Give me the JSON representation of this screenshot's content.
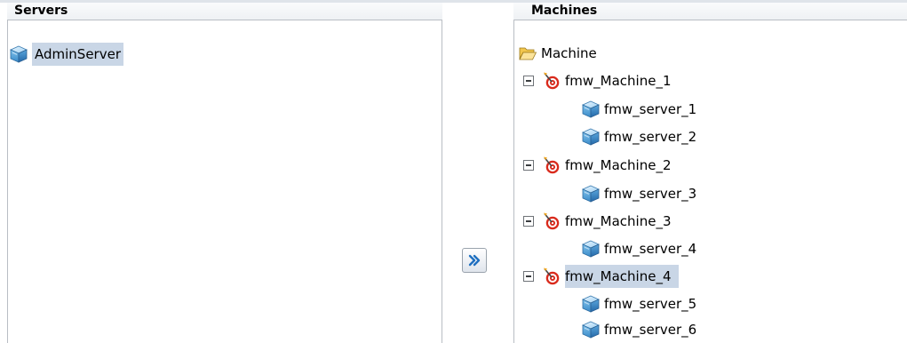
{
  "servers_panel": {
    "header": "Servers",
    "items": [
      {
        "label": "AdminServer",
        "icon": "server-icon",
        "selected": true
      }
    ]
  },
  "move_button": {
    "icon": "double-right-arrow-icon"
  },
  "machines_panel": {
    "header": "Machines",
    "root": {
      "label": "Machine",
      "icon": "folder-open-icon"
    },
    "machines": [
      {
        "label": "fmw_Machine_1",
        "icon": "machine-target-icon",
        "expanded": true,
        "servers": [
          {
            "label": "fmw_server_1"
          },
          {
            "label": "fmw_server_2"
          }
        ]
      },
      {
        "label": "fmw_Machine_2",
        "icon": "machine-target-icon",
        "expanded": true,
        "servers": [
          {
            "label": "fmw_server_3"
          }
        ]
      },
      {
        "label": "fmw_Machine_3",
        "icon": "machine-target-icon",
        "expanded": true,
        "servers": [
          {
            "label": "fmw_server_4"
          }
        ]
      },
      {
        "label": "fmw_Machine_4",
        "icon": "machine-target-icon",
        "expanded": true,
        "selected": true,
        "servers": [
          {
            "label": "fmw_server_5"
          },
          {
            "label": "fmw_server_6"
          }
        ]
      }
    ]
  }
}
